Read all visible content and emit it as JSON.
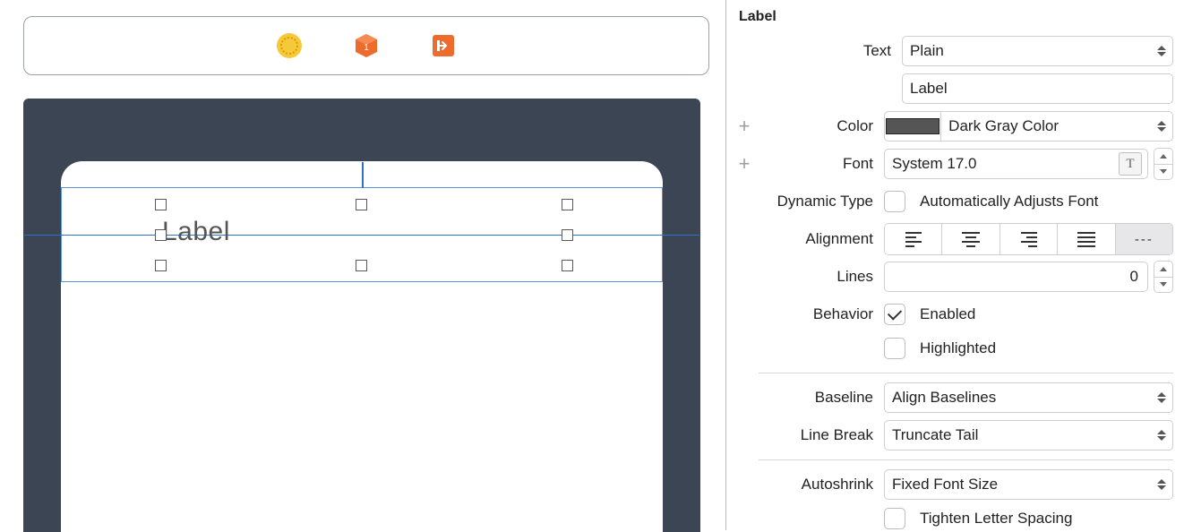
{
  "canvas": {
    "selected_label_text": "Label"
  },
  "inspector": {
    "section_title": "Label",
    "text_label": "Text",
    "text_style": "Plain",
    "text_value": "Label",
    "color_label": "Color",
    "color_value": "Dark Gray Color",
    "font_label": "Font",
    "font_value": "System 17.0",
    "dyntype_label": "Dynamic Type",
    "dyntype_check_label": "Automatically Adjusts Font",
    "dyntype_checked": false,
    "alignment_label": "Alignment",
    "alignment_selected": 4,
    "lines_label": "Lines",
    "lines_value": "0",
    "behavior_label": "Behavior",
    "behavior_enabled_label": "Enabled",
    "behavior_enabled_checked": true,
    "behavior_highlighted_label": "Highlighted",
    "behavior_highlighted_checked": false,
    "baseline_label": "Baseline",
    "baseline_value": "Align Baselines",
    "linebreak_label": "Line Break",
    "linebreak_value": "Truncate Tail",
    "autoshrink_label": "Autoshrink",
    "autoshrink_value": "Fixed Font Size",
    "autoshrink_tighten_label": "Tighten Letter Spacing"
  }
}
